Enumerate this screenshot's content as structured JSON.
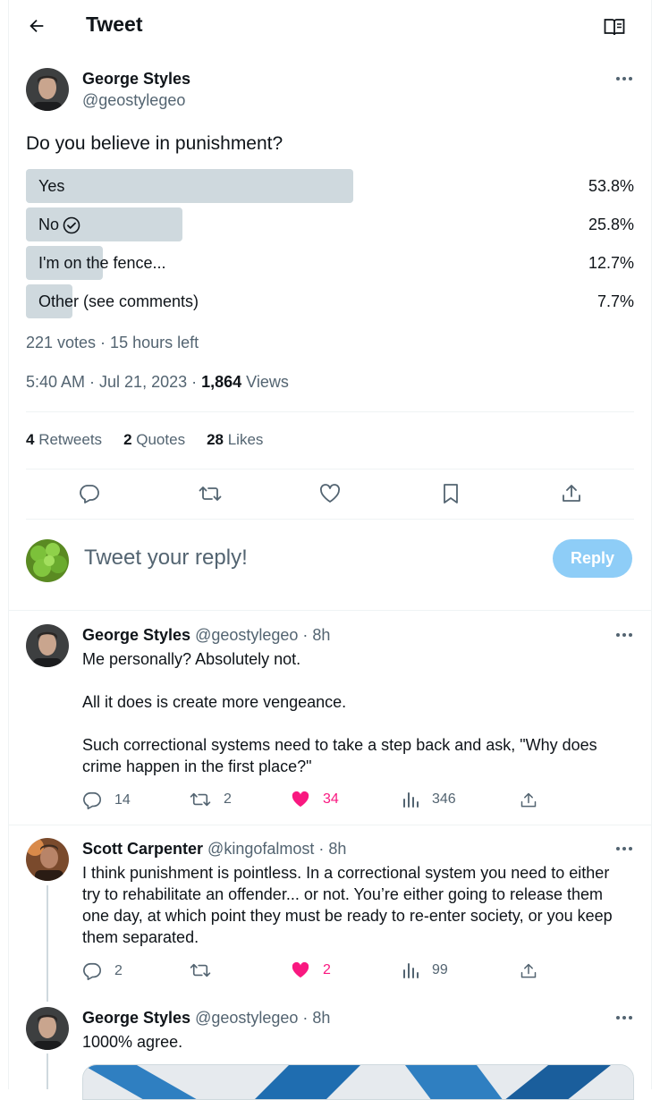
{
  "header": {
    "title": "Tweet"
  },
  "tweet": {
    "author_name": "George Styles",
    "author_handle": "@geostylegeo",
    "text": "Do you believe in punishment?",
    "poll": [
      {
        "label": "Yes",
        "percent": "53.8%",
        "fraction": 0.538,
        "selected": false
      },
      {
        "label": "No",
        "percent": "25.8%",
        "fraction": 0.258,
        "selected": true
      },
      {
        "label": "I'm on the fence...",
        "percent": "12.7%",
        "fraction": 0.127,
        "selected": false
      },
      {
        "label": "Other (see comments)",
        "percent": "7.7%",
        "fraction": 0.077,
        "selected": false
      }
    ],
    "poll_meta": "221 votes · 15 hours left",
    "timestamp": "5:40 AM · Jul 21, 2023 · ",
    "views_count": "1,864",
    "views_label": " Views",
    "retweets_count": "4",
    "retweets_label": " Retweets",
    "quotes_count": "2",
    "quotes_label": " Quotes",
    "likes_count": "28",
    "likes_label": " Likes"
  },
  "composer": {
    "placeholder": "Tweet your reply!",
    "button": "Reply"
  },
  "replies": [
    {
      "name": "George Styles",
      "meta": "@geostylegeo · 8h",
      "text_lines": [
        "Me personally?  Absolutely not.",
        "",
        "All it does is create more vengeance.",
        "",
        "Such correctional systems need to take a step back and ask, \"Why does",
        "crime happen in the first place?\""
      ],
      "replies": "14",
      "retweets": "2",
      "likes": "34",
      "views": "346"
    },
    {
      "name": "Scott Carpenter",
      "meta": "@kingofalmost · 8h",
      "text_lines": [
        "I think punishment is pointless. In a correctional system you need to either",
        "try to rehabilitate an offender... or not. You’re either going to release them",
        "one day, at which point they must be ready to re-enter society, or you keep",
        "them separated."
      ],
      "replies": "2",
      "retweets": "",
      "likes": "2",
      "views": "99"
    },
    {
      "name": "George Styles",
      "meta": "@geostylegeo · 8h",
      "text_lines": [
        "1000% agree."
      ]
    }
  ],
  "colors": {
    "accent": "#1d9bf0",
    "like": "#f91880",
    "muted": "#536471",
    "poll_bar": "#cfd9de"
  }
}
